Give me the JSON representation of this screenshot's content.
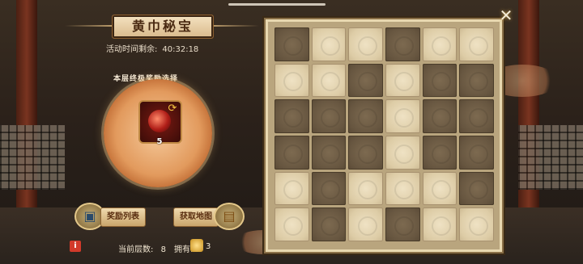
{
  "title": "黄巾秘宝",
  "timer": {
    "label": "活动时间剩余:",
    "value": "40:32:18"
  },
  "reward": {
    "title": "本层终极奖励选择",
    "count": "5"
  },
  "buttons": {
    "reward_list": "奖励列表",
    "get_map": "获取地图"
  },
  "bottom": {
    "floor_label": "当前层数:",
    "floor_value": "8",
    "own_label": "拥有:",
    "own_value": "3"
  },
  "close_symbol": "✕",
  "board": {
    "rows": [
      [
        "dark",
        "light",
        "light",
        "dark",
        "light",
        "light"
      ],
      [
        "light",
        "light",
        "dark",
        "light",
        "dark",
        "dark"
      ],
      [
        "dark",
        "dark",
        "dark",
        "light",
        "dark",
        "dark"
      ],
      [
        "dark",
        "dark",
        "dark",
        "light",
        "dark",
        "dark"
      ],
      [
        "light",
        "dark",
        "light",
        "light",
        "light",
        "dark"
      ],
      [
        "light",
        "dark",
        "light",
        "dark",
        "light",
        "light"
      ]
    ]
  },
  "icons": {
    "info": "i",
    "refresh": "⟳",
    "chest": "▣",
    "map": "▤"
  }
}
